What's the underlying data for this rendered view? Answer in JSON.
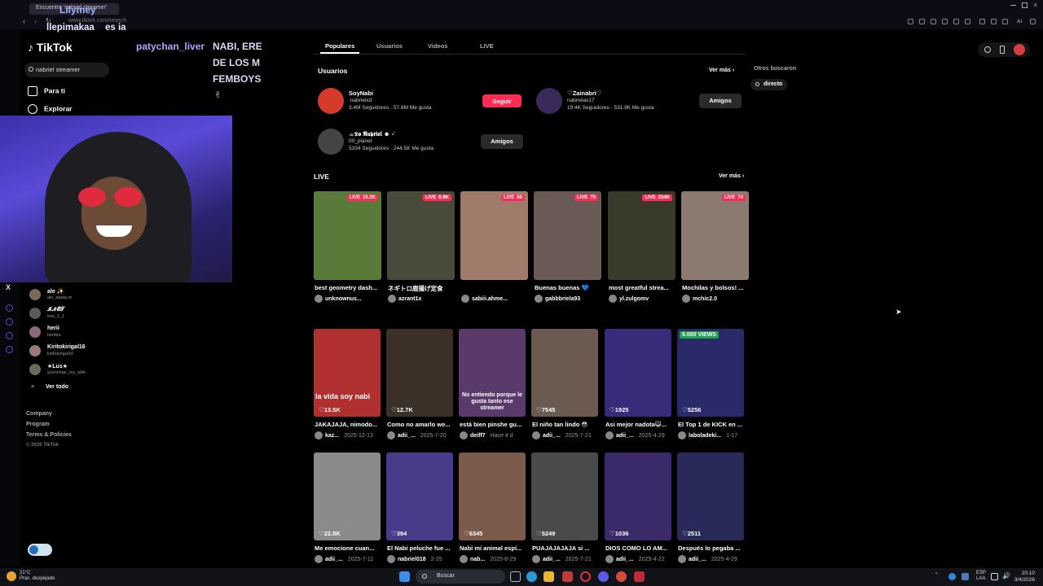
{
  "browser": {
    "tab_title": "Encuentra 'nabriel streamer'",
    "url": "www.tiktok.com/search"
  },
  "stream_overlay": {
    "username": "Lilymey",
    "title_line1": "llepimakaa",
    "title_line2": "es ia",
    "chat_user": "patychan_liver",
    "chat_lines": [
      "NABI, ERE",
      "DE LOS M",
      "FEMBOYS",
      "✌"
    ]
  },
  "sidebar": {
    "logo": "TikTok",
    "search_value": "nabriel streamer",
    "nav": [
      {
        "label": "Para ti",
        "icon": "home-icon"
      },
      {
        "label": "Explorar",
        "icon": "compass-icon"
      }
    ],
    "following": [
      {
        "name": "ale ✨",
        "sub": "ale_apata.m"
      },
      {
        "name": "𝓘𝓝𝓔𝓣",
        "sub": "inet_1_1"
      },
      {
        "name": "herii",
        "sub": "heriibo"
      },
      {
        "name": "Kiritokirigal16",
        "sub": "kiritokirigal16"
      },
      {
        "name": "★Lus★",
        "sub": "yoonchae_my_wife"
      }
    ],
    "see_all": "Ver todo",
    "footer": [
      "Company",
      "Program",
      "Terms & Policies"
    ],
    "copyright": "© 2026 TikTok"
  },
  "tabs": [
    "Populares",
    "Usuarios",
    "Videos",
    "LIVE"
  ],
  "users_section": {
    "title": "Usuarios",
    "see_more": "Ver más",
    "users": [
      {
        "name": "SoyNabi",
        "handle": ".nabrielxd",
        "stats": "3.4M Seguidores · 57.6M Me gusta",
        "button": "Seguir",
        "color": "#c0392b"
      },
      {
        "name": "♡Zainabri♡",
        "handle": "nabrielax17",
        "stats": "19.4K Seguidores · 531.9K Me gusta",
        "button": "Amigos",
        "color": "#3a2a5a"
      },
      {
        "name": "☕𝕯𝖔 𝕹𝖆𝖇𝖗𝖎𝖊𝖑 ☻ ᵕ̈",
        "handle": "00_planet",
        "stats": "5334 Seguidores · 244.5K Me gusta",
        "button": "Amigos",
        "color": "#444"
      }
    ]
  },
  "live_section": {
    "title": "LIVE",
    "see_more": "Ver más",
    "badge": "LIVE",
    "items": [
      {
        "viewers": "15.2K",
        "caption": "best geometry dash...",
        "user": "unknownus...",
        "color": "#5a7a3a"
      },
      {
        "viewers": "6.9K",
        "caption": "ネギトロ鹿撮げ定食",
        "user": "azrant1x",
        "color": "#4a4a3a"
      },
      {
        "viewers": "60",
        "caption": "",
        "user": "sabiii.ahme...",
        "color": "#a07a6a"
      },
      {
        "viewers": "75",
        "caption": "Buenas buenas 💙",
        "user": "gabbbriela93",
        "color": "#6a5a55"
      },
      {
        "viewers": "234K",
        "caption": "most greatful strea...",
        "user": "yl.zulgomv",
        "color": "#3a3a2a"
      },
      {
        "viewers": "74",
        "caption": "Mochilas y bolsos! ...",
        "user": "mchic2.0",
        "color": "#8a7a70"
      }
    ]
  },
  "videos_row1": [
    {
      "likes": "13.5K",
      "caption": "JAKAJAJA, nimodo...",
      "user": "kaz...",
      "date": "2025-12-13",
      "color": "#b03030"
    },
    {
      "likes": "12.7K",
      "caption": "Como no amarlo we...",
      "user": "adii_...",
      "date": "2025-7-20",
      "color": "#3a3028"
    },
    {
      "likes": "",
      "caption": "está bien pinshe gu...",
      "user": "deiff7",
      "date": "Hace 4 d",
      "color": "#5a3a6a"
    },
    {
      "likes": "7545",
      "caption": "El niño tan lindo 😳",
      "user": "adii_...",
      "date": "2025-7-21",
      "color": "#6a5a50"
    },
    {
      "likes": "1925",
      "caption": "Asi mejor nadota😺...",
      "user": "adii_...",
      "date": "2025-4-29",
      "color": "#3a2a7a"
    },
    {
      "likes": "5256",
      "caption": "El Top 1 de KICK en ...",
      "user": "laboladeki...",
      "date": "1-17",
      "color": "#2a2a6a"
    }
  ],
  "videos_row2": [
    {
      "likes": "22.8K",
      "caption": "Me emocione cuan...",
      "user": "adii_...",
      "date": "2025-7-11",
      "color": "#8a8a8a"
    },
    {
      "likes": "394",
      "caption": "El Nabi peluche fue ...",
      "user": "nabriel018",
      "date": "2-25",
      "color": "#4a3a8a"
    },
    {
      "likes": "6345",
      "caption": "Nabi mi animal espí...",
      "user": "nab...",
      "date": "2025-8-29",
      "color": "#7a5a4a"
    },
    {
      "likes": "5249",
      "caption": "PUAJAJAJAJA si ...",
      "user": "adii_...",
      "date": "2025-7-21",
      "color": "#4a4a4a"
    },
    {
      "likes": "1036",
      "caption": "DIOS COMO LO AM...",
      "user": "adii_...",
      "date": "2025-4-22",
      "color": "#3a2a6a"
    },
    {
      "likes": "2511",
      "caption": "Después lo pegaba ...",
      "user": "adii_...",
      "date": "2025-4-29",
      "color": "#2a2a5a"
    }
  ],
  "thumb_texts": {
    "v1": "la vida soy nabi",
    "v3": "No entiendo porque le gusta tanto ese streamer"
  },
  "views_badge": "5.000 VIEWS",
  "right_panel": {
    "title": "Otros buscaron",
    "chip": "directo"
  },
  "taskbar": {
    "weather_temp": "21°C",
    "weather_desc": "Prac. despejado",
    "search": "Buscar",
    "lang": "ESP",
    "lang2": "LAA",
    "time": "20:10",
    "date": "3/4/2026"
  }
}
